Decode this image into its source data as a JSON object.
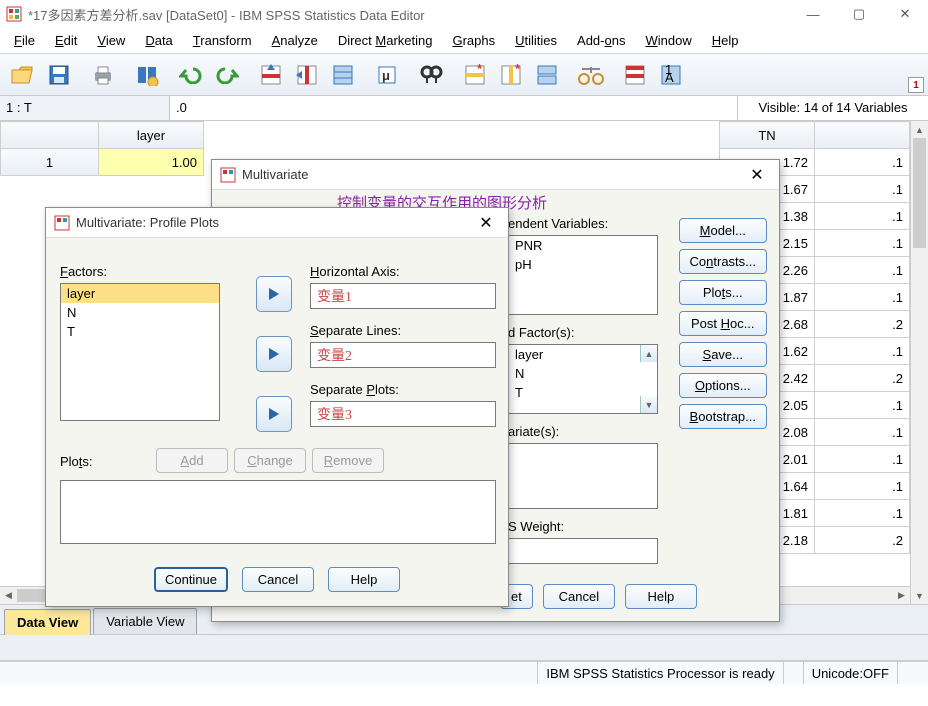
{
  "window": {
    "title": "*17多因素方差分析.sav [DataSet0] - IBM SPSS Statistics Data Editor"
  },
  "menu": {
    "file": "File",
    "edit": "Edit",
    "view": "View",
    "data": "Data",
    "transform": "Transform",
    "analyze": "Analyze",
    "direct_marketing": "Direct Marketing",
    "graphs": "Graphs",
    "utilities": "Utilities",
    "addons": "Add-ons",
    "window": "Window",
    "help": "Help"
  },
  "info": {
    "cell_ref": "1 : T",
    "cell_val": ".0",
    "visible": "Visible: 14 of 14 Variables"
  },
  "grid": {
    "col_layer": "layer",
    "col_tn": "TN",
    "row1": "1",
    "layer_vals": [
      "1.00"
    ],
    "tn_vals": [
      "1.72",
      "1.67",
      "1.38",
      "2.15",
      "2.26",
      "1.87",
      "2.68",
      "1.62",
      "2.42",
      "2.05",
      "2.08",
      "2.01",
      "1.64",
      "1.81",
      "2.18"
    ],
    "right_vals": [
      ".1",
      ".1",
      ".1",
      ".1",
      ".1",
      ".1",
      ".2",
      ".1",
      ".2",
      ".1",
      ".1",
      ".1",
      ".1",
      ".1",
      ".2"
    ]
  },
  "tabs": {
    "data_view": "Data View",
    "variable_view": "Variable View"
  },
  "status": {
    "processor": "IBM SPSS Statistics Processor is ready",
    "unicode": "Unicode:OFF"
  },
  "annotation": {
    "purple": "控制变量的交互作用的图形分析"
  },
  "multivar": {
    "title": "Multivariate",
    "dep_label": "endent Variables:",
    "dep": [
      "PNR",
      "pH"
    ],
    "fixed_label": "d Factor(s):",
    "fixed": [
      "layer",
      "N",
      "T"
    ],
    "covar_label": "ariate(s):",
    "wls_label": "S Weight:",
    "side": {
      "model": "Model...",
      "contrasts": "Contrasts...",
      "plots": "Plots...",
      "posthoc": "Post Hoc...",
      "save": "Save...",
      "options": "Options...",
      "bootstrap": "Bootstrap..."
    },
    "ok_partial": "et",
    "cancel": "Cancel",
    "help": "Help"
  },
  "plots": {
    "title": "Multivariate: Profile Plots",
    "factors_label": "Factors:",
    "factors": [
      "layer",
      "N",
      "T"
    ],
    "haxis_label": "Horizontal Axis:",
    "haxis_val": "变量1",
    "seplines_label": "Separate Lines:",
    "seplines_val": "变量2",
    "sepplots_label": "Separate Plots:",
    "sepplots_val": "变量3",
    "plots_label": "Plots:",
    "add": "Add",
    "change": "Change",
    "remove": "Remove",
    "continue": "Continue",
    "cancel": "Cancel",
    "help": "Help"
  }
}
